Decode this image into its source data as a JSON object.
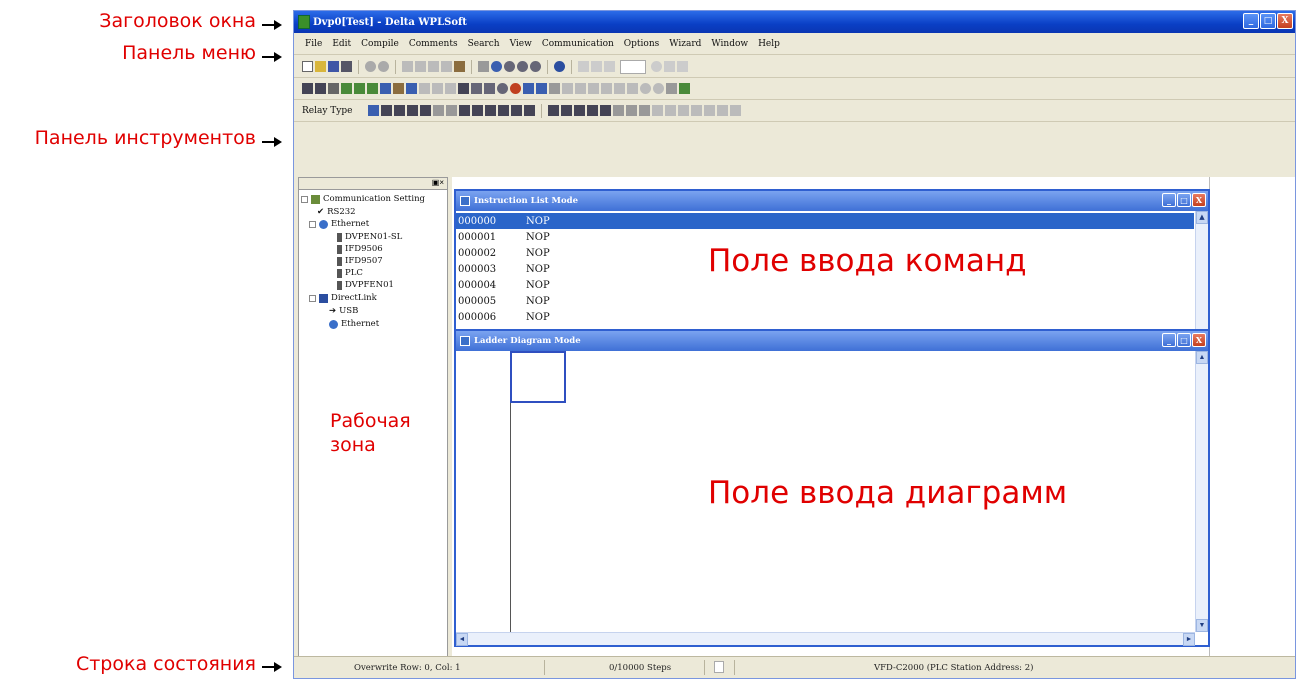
{
  "annotations": {
    "title_bar": "Заголовок окна",
    "menu_bar": "Панель меню",
    "toolbar": "Панель инструментов",
    "workspace": [
      "Рабочая",
      "зона"
    ],
    "instruction_field": "Поле ввода команд",
    "diagram_field": "Поле ввода диаграмм",
    "status_bar": "Строка состояния"
  },
  "window": {
    "title": "Dvp0[Test] - Delta WPLSoft",
    "buttons": [
      "_",
      "□",
      "X"
    ]
  },
  "menu": [
    "File",
    "Edit",
    "Compile",
    "Comments",
    "Search",
    "View",
    "Communication",
    "Options",
    "Wizard",
    "Window",
    "Help"
  ],
  "toolbar": {
    "relay_type_label": "Relay Type"
  },
  "tree": {
    "root": "Communication Setting",
    "rs232": "RS232",
    "ethernet": "Ethernet",
    "ethernet_items": [
      "DVPEN01-SL",
      "IFD9506",
      "IFD9507",
      "PLC",
      "DVPFEN01"
    ],
    "directlink": "DirectLink",
    "usb": "USB",
    "ethernet2": "Ethernet"
  },
  "instruction_window": {
    "title": "Instruction List Mode",
    "rows": [
      {
        "step": "000000",
        "op": "NOP"
      },
      {
        "step": "000001",
        "op": "NOP"
      },
      {
        "step": "000002",
        "op": "NOP"
      },
      {
        "step": "000003",
        "op": "NOP"
      },
      {
        "step": "000004",
        "op": "NOP"
      },
      {
        "step": "000005",
        "op": "NOP"
      },
      {
        "step": "000006",
        "op": "NOP"
      }
    ]
  },
  "ladder_window": {
    "title": "Ladder Diagram Mode"
  },
  "status": {
    "position": "Overwrite  Row: 0, Col: 1",
    "steps": "0/10000 Steps",
    "device": "VFD-C2000 (PLC Station Address: 2)"
  },
  "colors": {
    "annotation": "#e00000",
    "titlebar": "#0a3fc5",
    "selection": "#2b65c9"
  }
}
